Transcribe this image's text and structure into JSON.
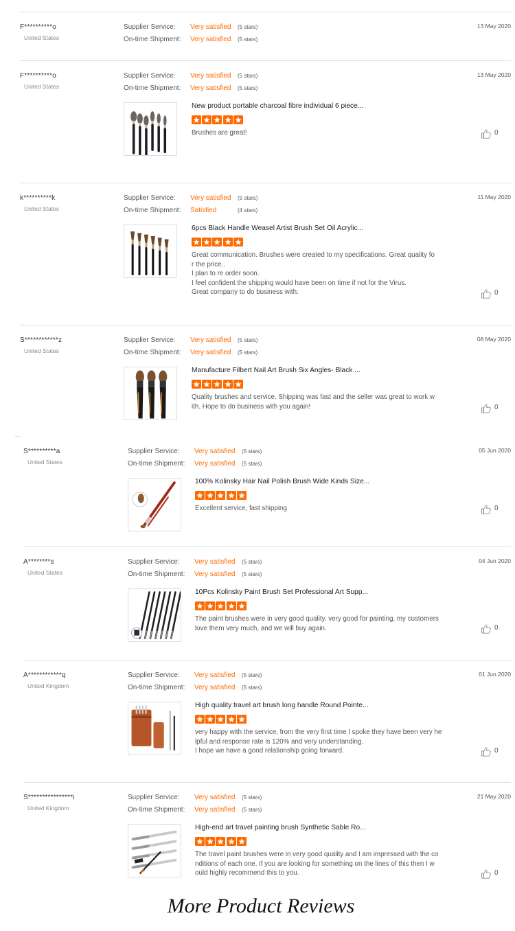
{
  "labels": {
    "supplier_service": "Supplier Service:",
    "ontime_shipment": "On-time Shipment:"
  },
  "colors": {
    "accent": "#ff6a00",
    "rule": "#dcdcdc"
  },
  "reviews": [
    {
      "buyer": "F**********o",
      "country": "United States",
      "date": "13 May 2020",
      "supplier": {
        "text": "Very satisfied",
        "stars": "(5 stars)"
      },
      "shipment": {
        "text": "Very satisfied",
        "stars": "(5 stars)"
      }
    },
    {
      "buyer": "F**********o",
      "country": "United States",
      "date": "13 May 2020",
      "supplier": {
        "text": "Very satisfied",
        "stars": "(5 stars)"
      },
      "shipment": {
        "text": "Very satisfied",
        "stars": "(5 stars)"
      },
      "product": "New product portable charcoal fibre individual 6 piece...",
      "rating": 5,
      "text": [
        "Brushes are great!"
      ],
      "likes": "0"
    },
    {
      "buyer": "k**********k",
      "country": "United States",
      "date": "11 May 2020",
      "supplier": {
        "text": "Very satisfied",
        "stars": "(5 stars)"
      },
      "shipment": {
        "text": "Satisfied",
        "stars": "(4 stars)"
      },
      "product": "6pcs Black Handle Weasel Artist Brush Set Oil Acrylic...",
      "rating": 5,
      "text": [
        "Great communication. Brushes were created to my specifications. Great quality fo",
        "r the price..",
        "I plan to re order soon.",
        "I feel confident the shipping would have been on time if not for the Virus.",
        "Great company to do business with."
      ],
      "likes": "0"
    },
    {
      "buyer": "S************z",
      "country": "United States",
      "date": "08 May 2020",
      "supplier": {
        "text": "Very satisfied",
        "stars": "(5 stars)"
      },
      "shipment": {
        "text": "Very satisfied",
        "stars": "(5 stars)"
      },
      "product": "Manufacture Filbert Nail Art Brush Six Angles- Black ...",
      "rating": 5,
      "text": [
        "Quality brushes and service. Shipping was fast and the seller was great to work w",
        "ith. Hope to do business with you again!"
      ],
      "likes": "0"
    },
    {
      "buyer": "S**********a",
      "country": "United States",
      "date": "05 Jun 2020",
      "supplier": {
        "text": "Very satisfied",
        "stars": "(5 stars)"
      },
      "shipment": {
        "text": "Very satisfied",
        "stars": "(5 stars)"
      },
      "product": "100% Kolinsky Hair Nail Polish Brush Wide Kinds Size...",
      "rating": 5,
      "text": [
        "Excellent service, fast shipping"
      ],
      "likes": "0"
    },
    {
      "buyer": "A********s",
      "country": "United States",
      "date": "04 Jun 2020",
      "supplier": {
        "text": "Very satisfied",
        "stars": "(5 stars)"
      },
      "shipment": {
        "text": "Very satisfied",
        "stars": "(5 stars)"
      },
      "product": "10Pcs Kolinsky Paint Brush Set Professional Art Supp...",
      "rating": 5,
      "text": [
        "The paint brushes were in very good quality. very good for painting, my customers",
        "love them very much, and we will buy again."
      ],
      "likes": "0"
    },
    {
      "buyer": "A************q",
      "country": "United Kingdom",
      "date": "01 Jun 2020",
      "supplier": {
        "text": "Very satisfied",
        "stars": "(5 stars)"
      },
      "shipment": {
        "text": "Very satisfied",
        "stars": "(5 stars)"
      },
      "product": "High quality travel art brush long handle Round Pointe...",
      "rating": 5,
      "text": [
        "very happy with the service, from the very first time I spoke they have been very he",
        "lpful and response rate is 120% and very understanding.",
        "I hope we have a good relationship going forward."
      ],
      "likes": "0"
    },
    {
      "buyer": "S****************i",
      "country": "United Kingdom",
      "date": "21 May 2020",
      "supplier": {
        "text": "Very satisfied",
        "stars": "(5 stars)"
      },
      "shipment": {
        "text": "Very satisfied",
        "stars": "(5 stars)"
      },
      "product": "High-end art travel painting brush Synthetic Sable Ro...",
      "rating": 5,
      "text": [
        "The travel paint brushes were in very good quality and I am impressed with the co",
        "nditions of each one. If you are looking for something on the lines of this then I w",
        "ould highly recommend this to you."
      ],
      "likes": "0"
    }
  ],
  "footer": {
    "title": "More Product Reviews"
  },
  "icons": {
    "star": "star-icon",
    "like": "thumbs-up-icon"
  }
}
